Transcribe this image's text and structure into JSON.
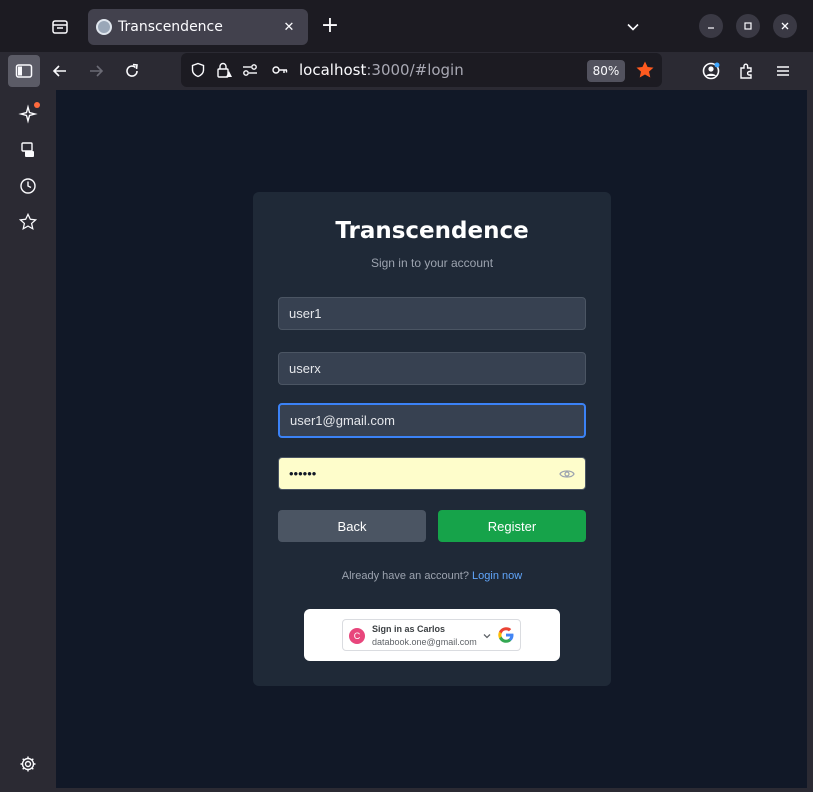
{
  "browser": {
    "tab": {
      "title": "Transcendence"
    },
    "new_tab_label": "+",
    "url": {
      "host": "localhost",
      "rest": ":3000/#login"
    },
    "zoom": "80%"
  },
  "login": {
    "title": "Transcendence",
    "subtitle": "Sign in to your account",
    "fields": {
      "username": "user1",
      "display_name": "userx",
      "email": "user1@gmail.com",
      "password_masked": "••••••"
    },
    "back_label": "Back",
    "register_label": "Register",
    "already_text": "Already have an account?",
    "login_link": "Login now"
  },
  "google": {
    "avatar_letter": "C",
    "signin_label": "Sign in as Carlos",
    "email": "databook.one@gmail.com"
  },
  "colors": {
    "accent_green": "#16a34a",
    "focus_blue": "#3b82f6",
    "link_blue": "#60a5fa",
    "page_bg": "#111827",
    "card_bg": "#1f2937"
  }
}
